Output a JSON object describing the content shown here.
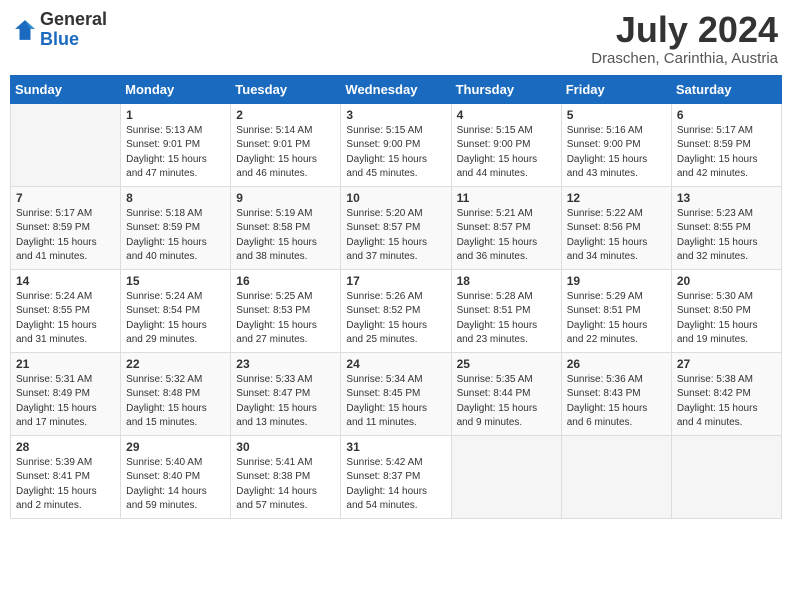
{
  "header": {
    "logo_general": "General",
    "logo_blue": "Blue",
    "month_year": "July 2024",
    "location": "Draschen, Carinthia, Austria"
  },
  "weekdays": [
    "Sunday",
    "Monday",
    "Tuesday",
    "Wednesday",
    "Thursday",
    "Friday",
    "Saturday"
  ],
  "weeks": [
    [
      {
        "day": "",
        "info": ""
      },
      {
        "day": "1",
        "info": "Sunrise: 5:13 AM\nSunset: 9:01 PM\nDaylight: 15 hours\nand 47 minutes."
      },
      {
        "day": "2",
        "info": "Sunrise: 5:14 AM\nSunset: 9:01 PM\nDaylight: 15 hours\nand 46 minutes."
      },
      {
        "day": "3",
        "info": "Sunrise: 5:15 AM\nSunset: 9:00 PM\nDaylight: 15 hours\nand 45 minutes."
      },
      {
        "day": "4",
        "info": "Sunrise: 5:15 AM\nSunset: 9:00 PM\nDaylight: 15 hours\nand 44 minutes."
      },
      {
        "day": "5",
        "info": "Sunrise: 5:16 AM\nSunset: 9:00 PM\nDaylight: 15 hours\nand 43 minutes."
      },
      {
        "day": "6",
        "info": "Sunrise: 5:17 AM\nSunset: 8:59 PM\nDaylight: 15 hours\nand 42 minutes."
      }
    ],
    [
      {
        "day": "7",
        "info": "Sunrise: 5:17 AM\nSunset: 8:59 PM\nDaylight: 15 hours\nand 41 minutes."
      },
      {
        "day": "8",
        "info": "Sunrise: 5:18 AM\nSunset: 8:59 PM\nDaylight: 15 hours\nand 40 minutes."
      },
      {
        "day": "9",
        "info": "Sunrise: 5:19 AM\nSunset: 8:58 PM\nDaylight: 15 hours\nand 38 minutes."
      },
      {
        "day": "10",
        "info": "Sunrise: 5:20 AM\nSunset: 8:57 PM\nDaylight: 15 hours\nand 37 minutes."
      },
      {
        "day": "11",
        "info": "Sunrise: 5:21 AM\nSunset: 8:57 PM\nDaylight: 15 hours\nand 36 minutes."
      },
      {
        "day": "12",
        "info": "Sunrise: 5:22 AM\nSunset: 8:56 PM\nDaylight: 15 hours\nand 34 minutes."
      },
      {
        "day": "13",
        "info": "Sunrise: 5:23 AM\nSunset: 8:55 PM\nDaylight: 15 hours\nand 32 minutes."
      }
    ],
    [
      {
        "day": "14",
        "info": "Sunrise: 5:24 AM\nSunset: 8:55 PM\nDaylight: 15 hours\nand 31 minutes."
      },
      {
        "day": "15",
        "info": "Sunrise: 5:24 AM\nSunset: 8:54 PM\nDaylight: 15 hours\nand 29 minutes."
      },
      {
        "day": "16",
        "info": "Sunrise: 5:25 AM\nSunset: 8:53 PM\nDaylight: 15 hours\nand 27 minutes."
      },
      {
        "day": "17",
        "info": "Sunrise: 5:26 AM\nSunset: 8:52 PM\nDaylight: 15 hours\nand 25 minutes."
      },
      {
        "day": "18",
        "info": "Sunrise: 5:28 AM\nSunset: 8:51 PM\nDaylight: 15 hours\nand 23 minutes."
      },
      {
        "day": "19",
        "info": "Sunrise: 5:29 AM\nSunset: 8:51 PM\nDaylight: 15 hours\nand 22 minutes."
      },
      {
        "day": "20",
        "info": "Sunrise: 5:30 AM\nSunset: 8:50 PM\nDaylight: 15 hours\nand 19 minutes."
      }
    ],
    [
      {
        "day": "21",
        "info": "Sunrise: 5:31 AM\nSunset: 8:49 PM\nDaylight: 15 hours\nand 17 minutes."
      },
      {
        "day": "22",
        "info": "Sunrise: 5:32 AM\nSunset: 8:48 PM\nDaylight: 15 hours\nand 15 minutes."
      },
      {
        "day": "23",
        "info": "Sunrise: 5:33 AM\nSunset: 8:47 PM\nDaylight: 15 hours\nand 13 minutes."
      },
      {
        "day": "24",
        "info": "Sunrise: 5:34 AM\nSunset: 8:45 PM\nDaylight: 15 hours\nand 11 minutes."
      },
      {
        "day": "25",
        "info": "Sunrise: 5:35 AM\nSunset: 8:44 PM\nDaylight: 15 hours\nand 9 minutes."
      },
      {
        "day": "26",
        "info": "Sunrise: 5:36 AM\nSunset: 8:43 PM\nDaylight: 15 hours\nand 6 minutes."
      },
      {
        "day": "27",
        "info": "Sunrise: 5:38 AM\nSunset: 8:42 PM\nDaylight: 15 hours\nand 4 minutes."
      }
    ],
    [
      {
        "day": "28",
        "info": "Sunrise: 5:39 AM\nSunset: 8:41 PM\nDaylight: 15 hours\nand 2 minutes."
      },
      {
        "day": "29",
        "info": "Sunrise: 5:40 AM\nSunset: 8:40 PM\nDaylight: 14 hours\nand 59 minutes."
      },
      {
        "day": "30",
        "info": "Sunrise: 5:41 AM\nSunset: 8:38 PM\nDaylight: 14 hours\nand 57 minutes."
      },
      {
        "day": "31",
        "info": "Sunrise: 5:42 AM\nSunset: 8:37 PM\nDaylight: 14 hours\nand 54 minutes."
      },
      {
        "day": "",
        "info": ""
      },
      {
        "day": "",
        "info": ""
      },
      {
        "day": "",
        "info": ""
      }
    ]
  ]
}
